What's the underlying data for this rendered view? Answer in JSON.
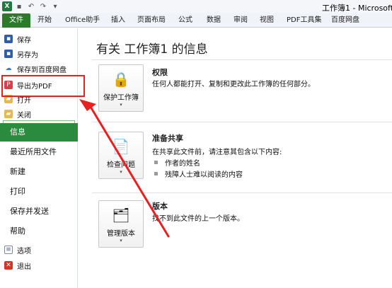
{
  "window": {
    "title": "工作簿1 - Microsoft Exc"
  },
  "qat": {
    "icons": [
      "excel-logo",
      "save-icon",
      "undo-icon",
      "redo-icon",
      "customize-icon"
    ]
  },
  "tabs": [
    "文件",
    "开始",
    "Office助手",
    "插入",
    "页面布局",
    "公式",
    "数据",
    "审阅",
    "视图",
    "PDF工具集",
    "百度网盘"
  ],
  "nav": {
    "save": "保存",
    "save_as": "另存为",
    "save_baidu": "保存到百度网盘",
    "export_pdf": "导出为PDF",
    "open": "打开",
    "close": "关闭",
    "info": "信息",
    "recent": "最近所用文件",
    "new": "新建",
    "print": "打印",
    "save_send": "保存并发送",
    "help": "帮助",
    "options": "选项",
    "exit": "退出"
  },
  "main": {
    "title": "有关 工作簿1 的信息",
    "permissions": {
      "button": "保护工作簿",
      "title": "权限",
      "desc": "任何人都能打开、复制和更改此工作簿的任何部分。"
    },
    "prepare": {
      "button": "检查问题",
      "title": "准备共享",
      "desc": "在共享此文件前，请注意其包含以下内容:",
      "items": [
        "作者的姓名",
        "残障人士难以阅读的内容"
      ]
    },
    "versions": {
      "button": "管理版本",
      "title": "版本",
      "desc": "找不到此文件的上一个版本。"
    }
  },
  "colors": {
    "file_tab": "#2a7a2a",
    "info_selected": "#2a8a3e",
    "annotation_red": "#e82020"
  }
}
